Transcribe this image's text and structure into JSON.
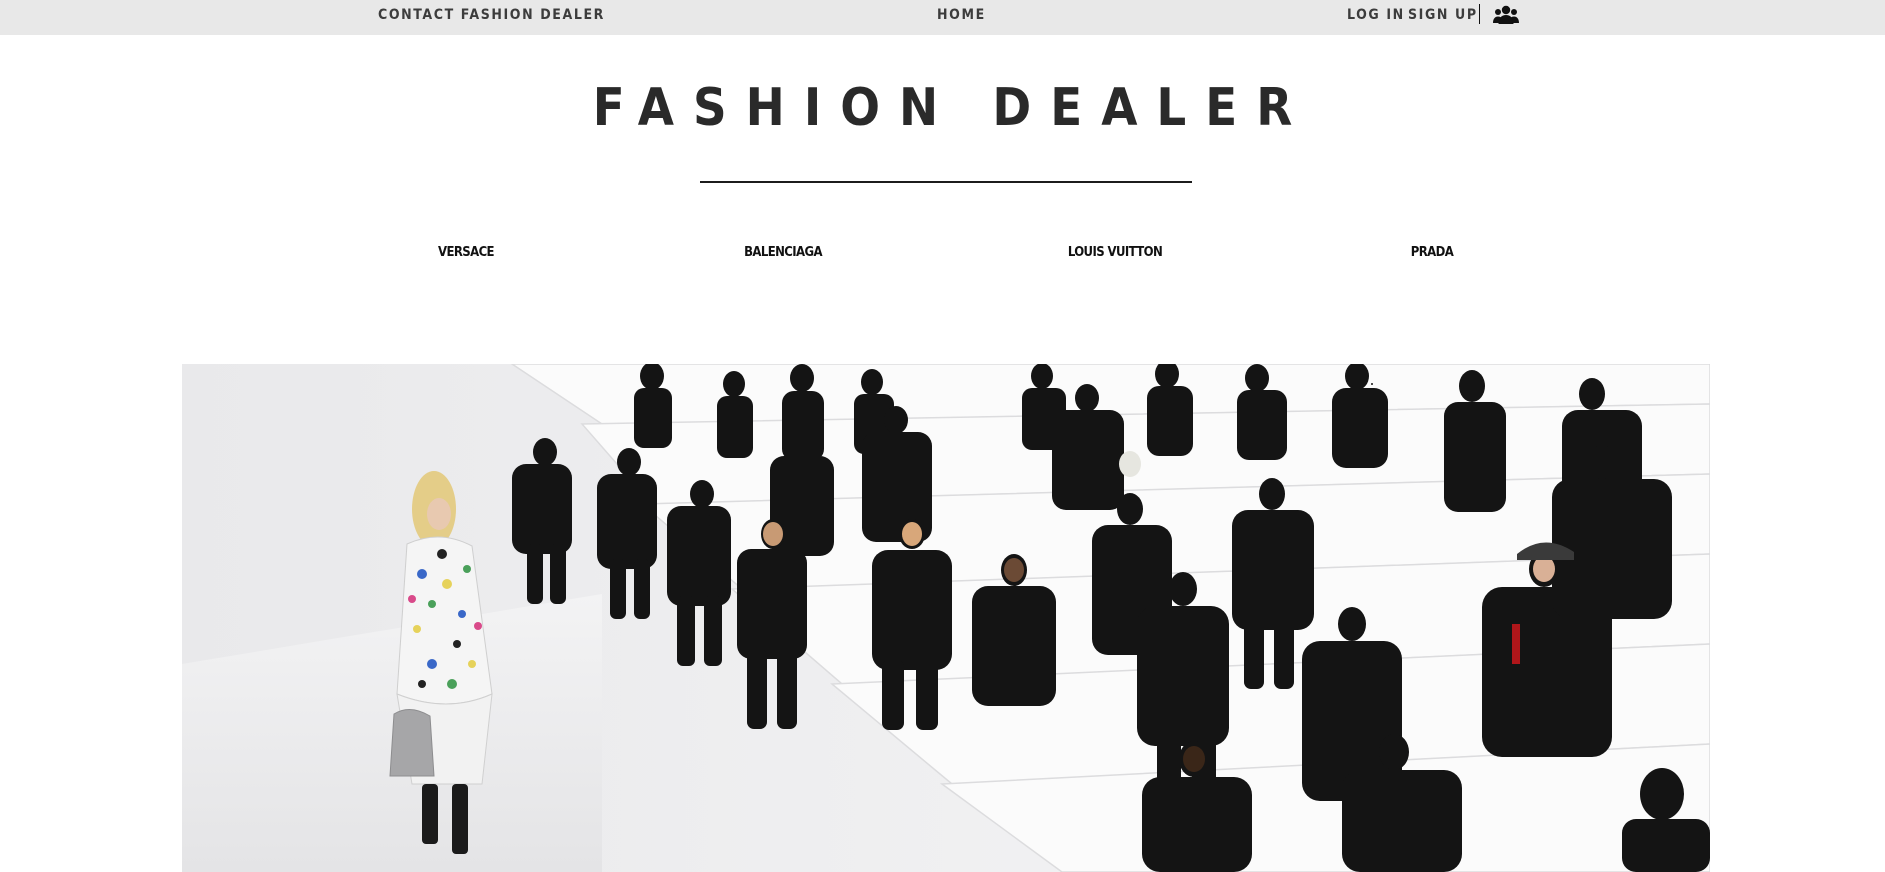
{
  "topbar": {
    "contact_label": "CONTACT FASHION DEALER",
    "home_label": "HOME",
    "login_label": "LOG IN",
    "signup_label": "SIGN UP",
    "members_icon": "members-icon"
  },
  "header": {
    "site_title": "FASHION DEALER"
  },
  "brands": {
    "items": [
      {
        "label": "VERSACE"
      },
      {
        "label": "BALENCIAGA"
      },
      {
        "label": "LOUIS VUITTON"
      },
      {
        "label": "PRADA"
      }
    ]
  },
  "hero": {
    "image": "runway-show-photo"
  },
  "colors": {
    "topbar_bg": "#e8e8e8",
    "text": "#2b2b2b",
    "hero_bg": "#f1f1f2"
  }
}
